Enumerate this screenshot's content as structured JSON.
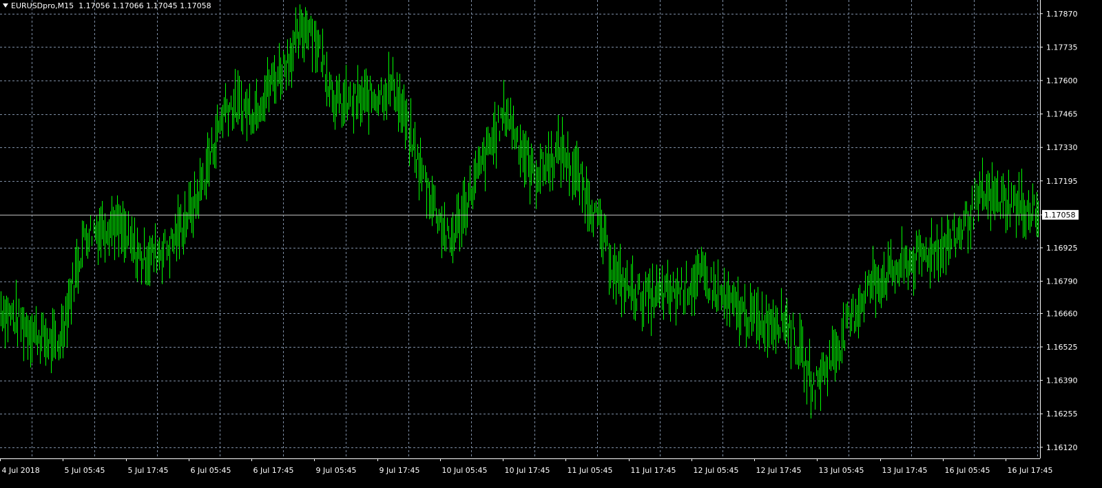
{
  "header": {
    "symbol": "EURUSDpro,M15",
    "open": "1.17056",
    "high": "1.17066",
    "low": "1.17045",
    "close": "1.17058"
  },
  "current_price_label": "1.17058",
  "colors": {
    "background": "#000000",
    "grid": "#7f8fa6",
    "bars": "#00ff00",
    "axis": "#ffffff",
    "price_line": "#c0c0c0"
  },
  "chart_data": {
    "type": "line",
    "title": "",
    "xlabel": "",
    "ylabel": "",
    "x_ticks": [
      "4 Jul 2018",
      "5 Jul 05:45",
      "5 Jul 17:45",
      "6 Jul 05:45",
      "6 Jul 17:45",
      "9 Jul 05:45",
      "9 Jul 17:45",
      "10 Jul 05:45",
      "10 Jul 17:45",
      "11 Jul 05:45",
      "11 Jul 17:45",
      "12 Jul 05:45",
      "12 Jul 17:45",
      "13 Jul 05:45",
      "13 Jul 17:45",
      "16 Jul 05:45",
      "16 Jul 17:45"
    ],
    "y_ticks": [
      1.1787,
      1.17735,
      1.176,
      1.17465,
      1.1733,
      1.17195,
      1.17058,
      1.16925,
      1.1679,
      1.1666,
      1.16525,
      1.1639,
      1.16255,
      1.1612
    ],
    "y_tick_labels": [
      "1.17870",
      "1.17735",
      "1.17600",
      "1.17465",
      "1.17330",
      "1.17195",
      "1.17058",
      "1.16925",
      "1.16790",
      "1.16660",
      "1.16525",
      "1.16390",
      "1.16255",
      "1.16120"
    ],
    "ylim": [
      1.16075,
      1.17925
    ],
    "grid": true,
    "series": [
      {
        "name": "",
        "x_ticks_index": [
          0,
          0.5,
          1,
          1.5,
          2,
          2.5,
          3,
          3.5,
          4,
          4.5,
          5,
          5.5,
          6,
          6.5,
          7,
          7.5,
          8,
          8.5,
          9,
          9.5,
          10,
          10.5,
          11,
          11.5,
          12,
          12.5,
          13,
          13.5,
          14,
          14.5,
          15,
          15.5,
          16,
          16.17
        ],
        "values": [
          1.1668,
          1.166,
          1.1652,
          1.1698,
          1.1703,
          1.1688,
          1.1693,
          1.1712,
          1.175,
          1.1748,
          1.1765,
          1.1784,
          1.175,
          1.1752,
          1.1758,
          1.1723,
          1.1694,
          1.1722,
          1.1748,
          1.1722,
          1.1732,
          1.1712,
          1.1679,
          1.1672,
          1.1674,
          1.1681,
          1.1669,
          1.1663,
          1.1664,
          1.1636,
          1.1656,
          1.1678,
          1.1684,
          1.169,
          1.1696,
          1.1713,
          1.1711,
          1.1706
        ]
      }
    ]
  }
}
